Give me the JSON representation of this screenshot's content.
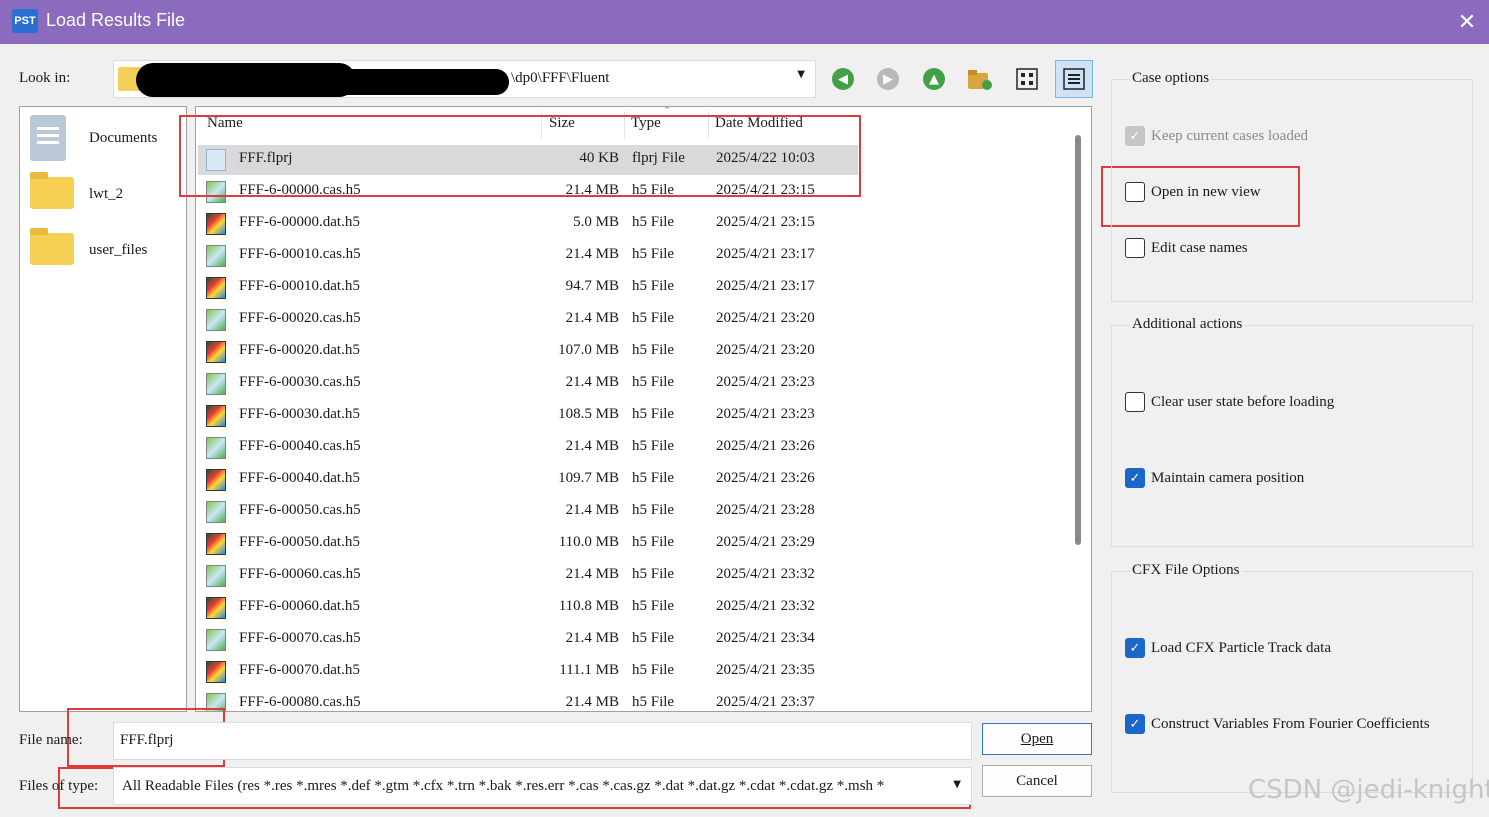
{
  "window": {
    "app_icon": "PST",
    "title": "Load Results File",
    "close_glyph": "✕"
  },
  "toolbar": {
    "look_in_label": "Look in:",
    "look_in_path": "\\dp0\\FFF\\Fluent",
    "dropdown_glyph": "▼",
    "icons": [
      "back-arrow-icon",
      "forward-arrow-icon",
      "up-folder-icon",
      "new-folder-icon",
      "icon-view-icon",
      "detail-view-icon"
    ]
  },
  "places": [
    {
      "label": "Documents",
      "icon": "documents-icon"
    },
    {
      "label": "lwt_2",
      "icon": "folder-icon"
    },
    {
      "label": "user_files",
      "icon": "folder-icon"
    }
  ],
  "file_list": {
    "columns": {
      "name": "Name",
      "size": "Size",
      "type": "Type",
      "date": "Date Modified"
    },
    "rows": [
      {
        "name": "FFF.flprj",
        "size": "40 KB",
        "type": "flprj File",
        "date": "2025/4/22 10:03",
        "kind": "prj",
        "selected": true
      },
      {
        "name": "FFF-6-00000.cas.h5",
        "size": "21.4 MB",
        "type": "h5 File",
        "date": "2025/4/21 23:15",
        "kind": "cas"
      },
      {
        "name": "FFF-6-00000.dat.h5",
        "size": "5.0 MB",
        "type": "h5 File",
        "date": "2025/4/21 23:15",
        "kind": "dat"
      },
      {
        "name": "FFF-6-00010.cas.h5",
        "size": "21.4 MB",
        "type": "h5 File",
        "date": "2025/4/21 23:17",
        "kind": "cas"
      },
      {
        "name": "FFF-6-00010.dat.h5",
        "size": "94.7 MB",
        "type": "h5 File",
        "date": "2025/4/21 23:17",
        "kind": "dat"
      },
      {
        "name": "FFF-6-00020.cas.h5",
        "size": "21.4 MB",
        "type": "h5 File",
        "date": "2025/4/21 23:20",
        "kind": "cas"
      },
      {
        "name": "FFF-6-00020.dat.h5",
        "size": "107.0 MB",
        "type": "h5 File",
        "date": "2025/4/21 23:20",
        "kind": "dat"
      },
      {
        "name": "FFF-6-00030.cas.h5",
        "size": "21.4 MB",
        "type": "h5 File",
        "date": "2025/4/21 23:23",
        "kind": "cas"
      },
      {
        "name": "FFF-6-00030.dat.h5",
        "size": "108.5 MB",
        "type": "h5 File",
        "date": "2025/4/21 23:23",
        "kind": "dat"
      },
      {
        "name": "FFF-6-00040.cas.h5",
        "size": "21.4 MB",
        "type": "h5 File",
        "date": "2025/4/21 23:26",
        "kind": "cas"
      },
      {
        "name": "FFF-6-00040.dat.h5",
        "size": "109.7 MB",
        "type": "h5 File",
        "date": "2025/4/21 23:26",
        "kind": "dat"
      },
      {
        "name": "FFF-6-00050.cas.h5",
        "size": "21.4 MB",
        "type": "h5 File",
        "date": "2025/4/21 23:28",
        "kind": "cas"
      },
      {
        "name": "FFF-6-00050.dat.h5",
        "size": "110.0 MB",
        "type": "h5 File",
        "date": "2025/4/21 23:29",
        "kind": "dat"
      },
      {
        "name": "FFF-6-00060.cas.h5",
        "size": "21.4 MB",
        "type": "h5 File",
        "date": "2025/4/21 23:32",
        "kind": "cas"
      },
      {
        "name": "FFF-6-00060.dat.h5",
        "size": "110.8 MB",
        "type": "h5 File",
        "date": "2025/4/21 23:32",
        "kind": "dat"
      },
      {
        "name": "FFF-6-00070.cas.h5",
        "size": "21.4 MB",
        "type": "h5 File",
        "date": "2025/4/21 23:34",
        "kind": "cas"
      },
      {
        "name": "FFF-6-00070.dat.h5",
        "size": "111.1 MB",
        "type": "h5 File",
        "date": "2025/4/21 23:35",
        "kind": "dat"
      },
      {
        "name": "FFF-6-00080.cas.h5",
        "size": "21.4 MB",
        "type": "h5 File",
        "date": "2025/4/21 23:37",
        "kind": "cas"
      }
    ]
  },
  "bottom": {
    "file_name_label": "File name:",
    "file_name_value": "FFF.flprj",
    "files_of_type_label": "Files of type:",
    "files_of_type_value": "All Readable Files (res *.res *.mres *.def *.gtm *.cfx *.trn *.bak *.res.err *.cas *.cas.gz *.dat *.dat.gz *.cdat *.cdat.gz *.msh *",
    "open_label": "Open",
    "cancel_label": "Cancel"
  },
  "options": {
    "case_options": {
      "title": "Case options",
      "items": [
        {
          "label": "Keep current cases loaded",
          "checked": true,
          "disabled": true
        },
        {
          "label": "Open in new view",
          "checked": false
        },
        {
          "label": "Edit case names",
          "checked": false
        }
      ]
    },
    "additional_actions": {
      "title": "Additional actions",
      "items": [
        {
          "label": "Clear user state before loading",
          "checked": false
        },
        {
          "label": "Maintain camera position",
          "checked": true
        }
      ]
    },
    "cfx_file_options": {
      "title": "CFX File Options",
      "items": [
        {
          "label": "Load CFX Particle Track data",
          "checked": true
        },
        {
          "label": "Construct Variables From Fourier Coefficients",
          "checked": true
        }
      ]
    }
  },
  "watermark": "CSDN @jedi-knight",
  "colors": {
    "titlebar": "#8a6bbd",
    "highlight_box": "#e03a3a",
    "checkbox_checked": "#1a66c9"
  }
}
